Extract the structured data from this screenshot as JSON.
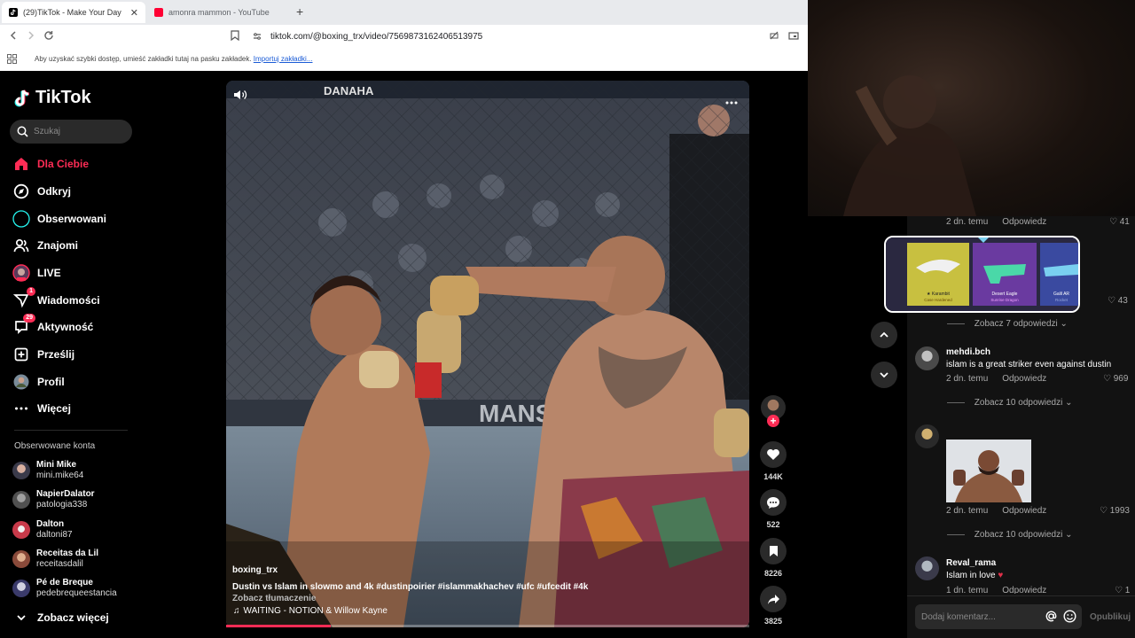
{
  "browser": {
    "tabs": [
      {
        "title": "(29)TikTok - Make Your Day",
        "active": true
      },
      {
        "title": "amonra mammon - YouTube",
        "active": false
      }
    ],
    "new_tab": "+",
    "url": "tiktok.com/@boxing_trx/video/7569873162406513975",
    "bookmarks_message": "Aby uzyskać szybki dostęp, umieść zakładki tutaj na pasku zakładek.",
    "bookmarks_link": "Importuj zakładki..."
  },
  "sidebar": {
    "logo": "TikTok",
    "search_placeholder": "Szukaj",
    "nav": [
      {
        "label": "Dla Ciebie",
        "icon": "home-icon",
        "active": true
      },
      {
        "label": "Odkryj",
        "icon": "compass-icon"
      },
      {
        "label": "Obserwowani",
        "icon": "following-icon"
      },
      {
        "label": "Znajomi",
        "icon": "friends-icon"
      },
      {
        "label": "LIVE",
        "icon": "live-icon"
      },
      {
        "label": "Wiadomości",
        "icon": "messages-icon",
        "badge": "1"
      },
      {
        "label": "Aktywność",
        "icon": "activity-icon",
        "badge": "29"
      },
      {
        "label": "Prześlij",
        "icon": "upload-icon"
      },
      {
        "label": "Profil",
        "icon": "profile-icon"
      },
      {
        "label": "Więcej",
        "icon": "more-icon"
      }
    ],
    "followed_title": "Obserwowane konta",
    "accounts": [
      {
        "name": "Mini Mike",
        "handle": "mini.mike64"
      },
      {
        "name": "NapierDalator",
        "handle": "patologia338"
      },
      {
        "name": "Dalton",
        "handle": "daltoni87"
      },
      {
        "name": "Receitas da Lil",
        "handle": "receitasdalil"
      },
      {
        "name": "Pé de Breque",
        "handle": "pedebrequeestancia"
      }
    ],
    "see_more": "Zobacz więcej"
  },
  "video": {
    "author": "boxing_trx",
    "caption": "Dustin vs Islam in slowmo and 4k #dustinpoirier #islammakhachev #ufc #ufcedit #4k",
    "translate": "Zobacz tłumaczenie",
    "music": "WAITING - NOTION & Willow Kayne",
    "progress": 0.2,
    "scene_text": {
      "banner_left": "DANAHA",
      "cage_text": "MANSO"
    }
  },
  "actions": {
    "likes": "144K",
    "comments": "522",
    "saves": "8226",
    "shares": "3825"
  },
  "comments": {
    "items": [
      {
        "time": "2 dn. temu",
        "reply": "Odpowiedz",
        "likes": "41"
      },
      {
        "image_labels": [
          "★ Karambit",
          "Case Hardened",
          "Desert Eagle",
          "Sunrise Dragon",
          "Galil AR",
          "Rocket"
        ],
        "likes": "43",
        "replies": "Zobacz 7 odpowiedzi"
      },
      {
        "user": "mehdi.bch",
        "text": "islam is a great striker even against dustin",
        "time": "2 dn. temu",
        "reply": "Odpowiedz",
        "likes": "969",
        "replies": "Zobacz 10 odpowiedzi"
      },
      {
        "time": "2 dn. temu",
        "reply": "Odpowiedz",
        "likes": "1993",
        "replies": "Zobacz 10 odpowiedzi"
      },
      {
        "user": "Reval_rama",
        "text": "Islam in love",
        "time": "1 dn. temu",
        "reply": "Odpowiedz",
        "likes": "1"
      }
    ],
    "input_placeholder": "Dodaj komentarz...",
    "post": "Opublikuj"
  },
  "colors": {
    "accent": "#fe2c55",
    "panel": "#121212"
  }
}
